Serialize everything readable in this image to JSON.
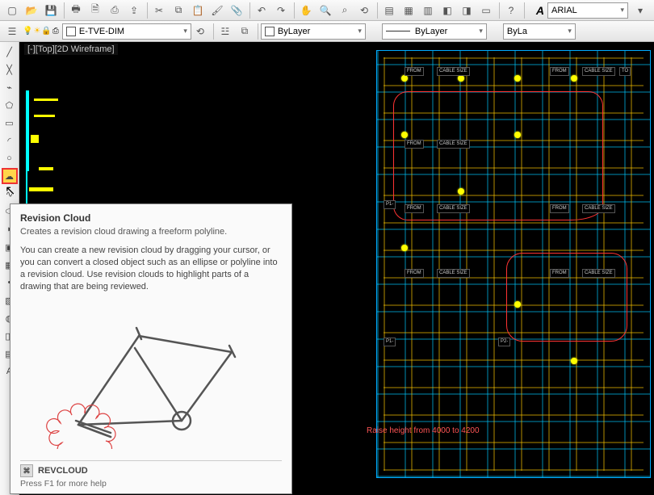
{
  "toolbar1": {
    "font_label_glyph": "A",
    "font_name": "ARIAL"
  },
  "toolbar2": {
    "layer_name": "E-TVE-DIM",
    "bylayer1": "ByLayer",
    "bylayer2": "ByLayer",
    "bylayer3": "ByLa"
  },
  "viewport": {
    "label": "[-][Top][2D Wireframe]"
  },
  "canvas_note": {
    "raise_height": "Raise height from 4000 to 4200"
  },
  "tooltip": {
    "title": "Revision Cloud",
    "subtitle": "Creates a revision cloud drawing a freeform polyline.",
    "body": "You can create a new revision cloud by dragging your cursor, or you can convert a closed object such as an ellipse or polyline into a revision cloud. Use revision clouds to highlight parts of a drawing that are being reviewed.",
    "command": "REVCLOUD",
    "help": "Press F1 for more help"
  },
  "floorplan_tags": {
    "cable": "CABLE SIZE",
    "from": "FROM",
    "to": "TO",
    "p1": "P1-",
    "p2": "P2-"
  }
}
